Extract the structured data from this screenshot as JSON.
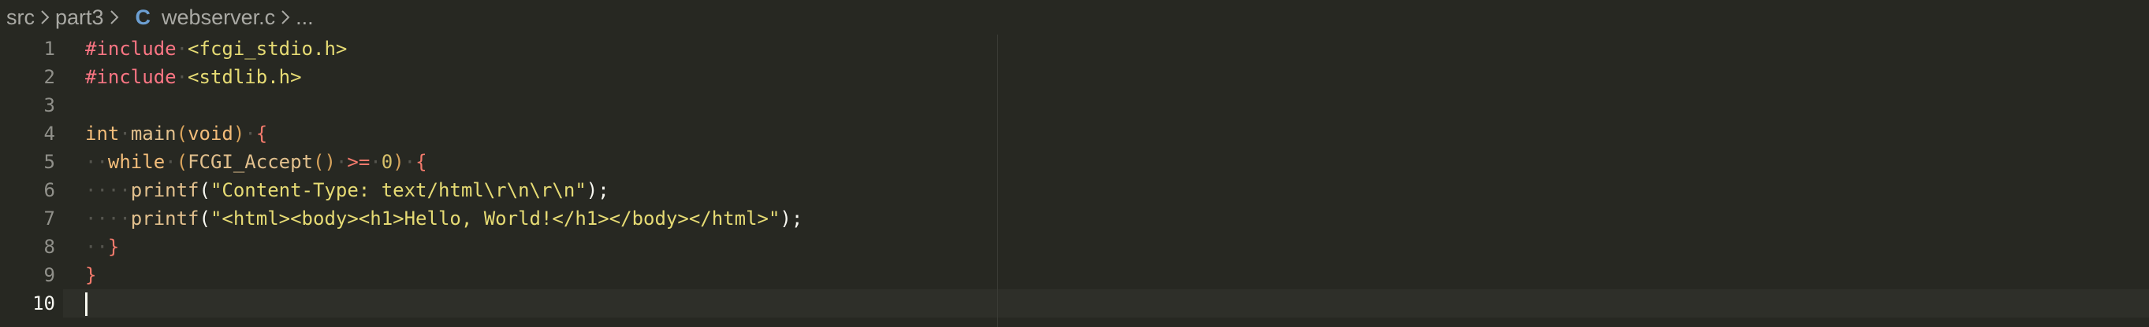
{
  "breadcrumb": {
    "segments": [
      "src",
      "part3",
      "webserver.c",
      "..."
    ],
    "file_icon": "C"
  },
  "editor": {
    "line_numbers": [
      "1",
      "2",
      "3",
      "4",
      "5",
      "6",
      "7",
      "8",
      "9",
      "10"
    ],
    "active_line": "10",
    "lines": {
      "l1": {
        "directive": "#include",
        "header": "<fcgi_stdio.h>"
      },
      "l2": {
        "directive": "#include",
        "header": "<stdlib.h>"
      },
      "l4": {
        "type": "int",
        "name": "main",
        "open": "(",
        "param": "void",
        "close": ")",
        "brace": "{"
      },
      "l5": {
        "kw": "while",
        "open": "(",
        "call": "FCGI_Accept",
        "call_parens": "()",
        "op": ">=",
        "num": "0",
        "close": ")",
        "brace": "{"
      },
      "l6": {
        "func": "printf",
        "open": "(",
        "str": "\"Content-Type: text/html\\r\\n\\r\\n\"",
        "end": ");"
      },
      "l7": {
        "func": "printf",
        "open": "(",
        "str": "\"<html><body><h1>Hello, World!</h1></body></html>\"",
        "end": ");"
      },
      "l8": {
        "brace": "}"
      },
      "l9": {
        "brace": "}"
      }
    }
  },
  "colors": {
    "background": "#272822",
    "directive": "#f97583",
    "string": "#e6db74",
    "keyword": "#f3bd7a",
    "brace": "#f47a6c",
    "line_number": "#90908a"
  }
}
